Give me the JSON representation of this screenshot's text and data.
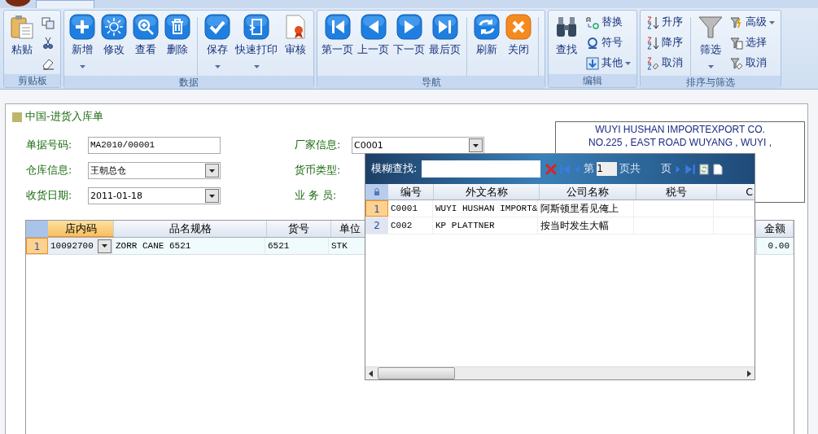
{
  "ribbon": {
    "groups": [
      {
        "label": "剪贴板",
        "items": [
          {
            "kind": "large",
            "label": "粘贴",
            "has_menu": false
          },
          {
            "kind": "small"
          },
          {
            "kind": "small"
          },
          {
            "kind": "small"
          }
        ]
      },
      {
        "label": "数据",
        "items": [
          {
            "kind": "large",
            "label": "新增",
            "has_menu": true
          },
          {
            "kind": "large",
            "label": "修改",
            "has_menu": false
          },
          {
            "kind": "large",
            "label": "查看",
            "has_menu": false
          },
          {
            "kind": "large",
            "label": "删除",
            "has_menu": false
          },
          {
            "kind": "separator"
          },
          {
            "kind": "large",
            "label": "保存",
            "has_menu": true
          },
          {
            "kind": "large",
            "label": "快速打印",
            "has_menu": true
          },
          {
            "kind": "large",
            "label": "审核",
            "has_menu": false
          }
        ]
      },
      {
        "label": "导航",
        "items": [
          {
            "kind": "large",
            "label": "第一页",
            "has_menu": false
          },
          {
            "kind": "large",
            "label": "上一页",
            "has_menu": false
          },
          {
            "kind": "large",
            "label": "下一页",
            "has_menu": false
          },
          {
            "kind": "large",
            "label": "最后页",
            "has_menu": false
          },
          {
            "kind": "separator"
          },
          {
            "kind": "large",
            "label": "刷新",
            "has_menu": false
          },
          {
            "kind": "large",
            "label": "关闭",
            "has_menu": false
          },
          {
            "kind": "separator"
          }
        ]
      },
      {
        "label": "编辑",
        "items": [
          {
            "kind": "large",
            "label": "查找",
            "has_menu": false
          },
          {
            "kind": "small",
            "label": "替换",
            "has_menu": false
          },
          {
            "kind": "small",
            "label": "符号",
            "has_menu": false
          },
          {
            "kind": "small",
            "label": "其他",
            "has_menu": true
          }
        ]
      },
      {
        "label": "排序与筛选",
        "items": [
          {
            "kind": "small",
            "label": "升序",
            "has_menu": false
          },
          {
            "kind": "small",
            "label": "降序",
            "has_menu": false
          },
          {
            "kind": "small",
            "label": "取消",
            "has_menu": false
          },
          {
            "kind": "separator"
          },
          {
            "kind": "large",
            "label": "筛选",
            "has_menu": true
          },
          {
            "kind": "small",
            "label": "高级",
            "has_menu": true
          },
          {
            "kind": "small",
            "label": "选择",
            "has_menu": false
          },
          {
            "kind": "small",
            "label": "取消",
            "has_menu": false
          }
        ]
      }
    ]
  },
  "form": {
    "title": "中国-进货入库单",
    "left_fields": [
      {
        "label": "单据号码:",
        "value": "MA2010/00001",
        "kind": "text"
      },
      {
        "label": "仓库信息:",
        "value": "王朝总仓",
        "kind": "combo"
      },
      {
        "label": "收货日期:",
        "value": "2011-01-18",
        "kind": "combo"
      }
    ],
    "right_fields": [
      {
        "label": "厂家信息:",
        "value": "C0001",
        "kind": "combo"
      },
      {
        "label": "货币类型:",
        "kind": "hidden"
      },
      {
        "label": "业 务 员:",
        "kind": "hidden"
      }
    ],
    "address": [
      "WUYI HUSHAN IMPORTEXPORT CO.",
      "NO.225 , EAST ROAD WUYANG , WUYI ,"
    ]
  },
  "grid": {
    "columns": [
      {
        "label": "店内码",
        "selected": true
      },
      {
        "label": "品名规格",
        "selected": false
      },
      {
        "label": "货号",
        "selected": false
      },
      {
        "label": "单位",
        "selected": false
      },
      {
        "label": "金额",
        "selected": false
      }
    ],
    "rows": [
      {
        "number": "1",
        "selected": true,
        "cells": [
          "10092700",
          "ZORR CANE 6521",
          "6521",
          "STK",
          "0.00"
        ]
      }
    ]
  },
  "lookup": {
    "search_label": "模糊查找:",
    "page_prefix": "第",
    "page": "1",
    "page_middle": "页共",
    "page_suffix": "页",
    "columns": [
      "编号",
      "外文名称",
      "公司名称",
      "税号",
      "C"
    ],
    "rows": [
      {
        "number": "1",
        "selected": true,
        "cells": [
          "C0001",
          "WUYI  HUSHAN IMPORT&",
          "阿斯顿里看见俺上",
          ""
        ]
      },
      {
        "number": "2",
        "selected": false,
        "cells": [
          "C002",
          "KP PLATTNER",
          "按当时发生大幅",
          ""
        ]
      }
    ]
  }
}
